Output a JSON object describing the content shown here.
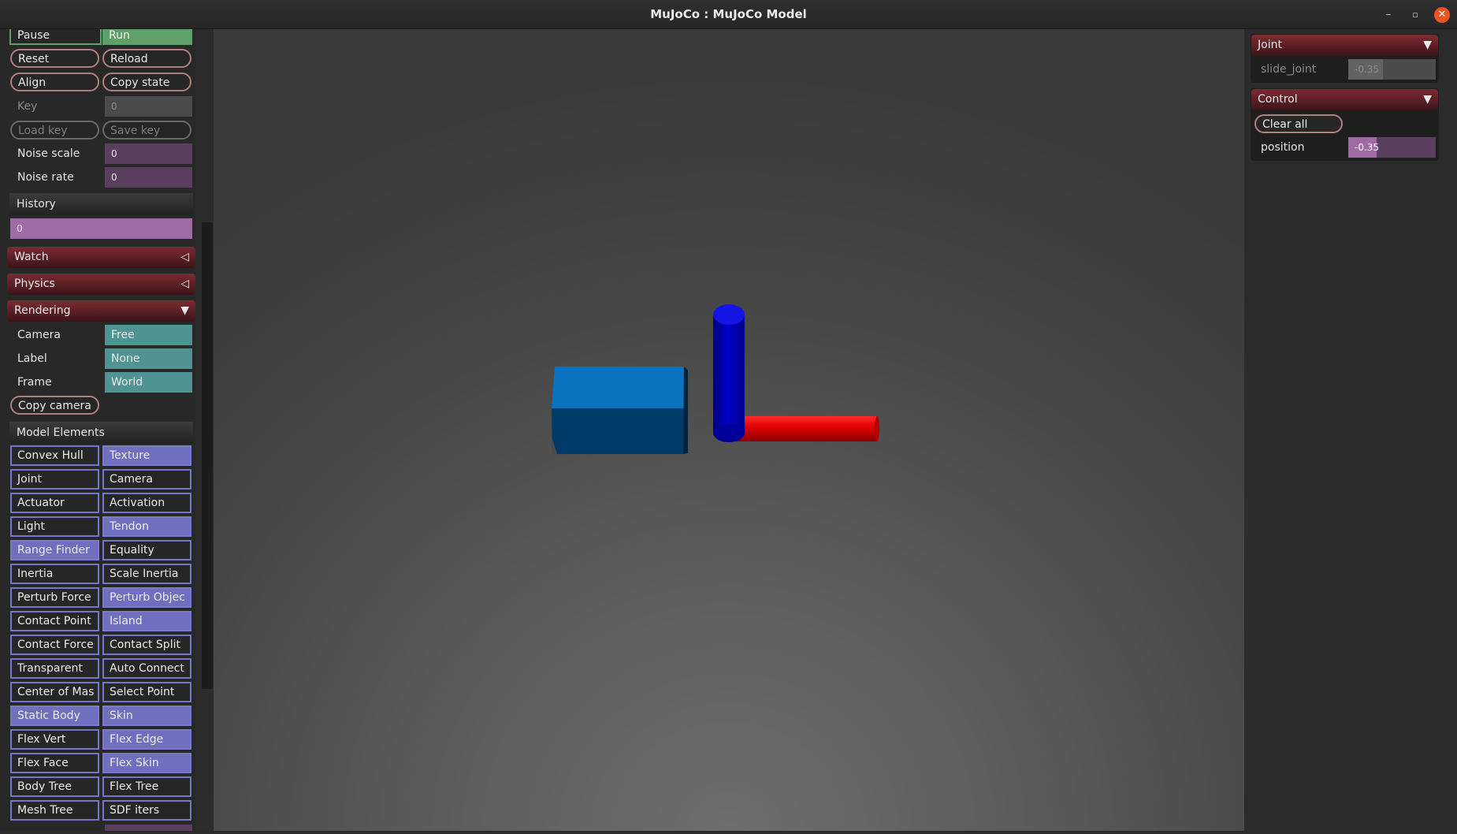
{
  "window": {
    "title": "MuJoCo : MuJoCo Model",
    "min_glyph": "–",
    "max_glyph": "▫",
    "close_glyph": "✕"
  },
  "simulation": {
    "pause_label": "Pause",
    "run_label": "Run",
    "reset_label": "Reset",
    "reload_label": "Reload",
    "align_label": "Align",
    "copy_state_label": "Copy state",
    "key_label": "Key",
    "key_value": "0",
    "load_key_label": "Load key",
    "save_key_label": "Save key",
    "noise_scale_label": "Noise scale",
    "noise_scale_value": "0",
    "noise_rate_label": "Noise rate",
    "noise_rate_value": "0",
    "history_label": "History",
    "history_value": "0"
  },
  "sections": {
    "watch": "Watch",
    "physics": "Physics",
    "rendering": "Rendering",
    "collapsed_arrow": "◁",
    "expanded_arrow": "▼"
  },
  "rendering": {
    "camera_label": "Camera",
    "camera_value": "Free",
    "label_label": "Label",
    "label_value": "None",
    "frame_label": "Frame",
    "frame_value": "World",
    "copy_camera_label": "Copy camera",
    "model_elements_label": "Model Elements"
  },
  "model_elements": [
    {
      "label": "Convex Hull",
      "on": false
    },
    {
      "label": "Texture",
      "on": true
    },
    {
      "label": "Joint",
      "on": false
    },
    {
      "label": "Camera",
      "on": false
    },
    {
      "label": "Actuator",
      "on": false
    },
    {
      "label": "Activation",
      "on": false
    },
    {
      "label": "Light",
      "on": false
    },
    {
      "label": "Tendon",
      "on": true
    },
    {
      "label": "Range Finder",
      "on": true
    },
    {
      "label": "Equality",
      "on": false
    },
    {
      "label": "Inertia",
      "on": false
    },
    {
      "label": "Scale Inertia",
      "on": false
    },
    {
      "label": "Perturb Force",
      "on": false
    },
    {
      "label": "Perturb Objec",
      "on": true
    },
    {
      "label": "Contact Point",
      "on": false
    },
    {
      "label": "Island",
      "on": true
    },
    {
      "label": "Contact Force",
      "on": false
    },
    {
      "label": "Contact Split",
      "on": false
    },
    {
      "label": "Transparent",
      "on": false
    },
    {
      "label": "Auto Connect",
      "on": false
    },
    {
      "label": "Center of Mas",
      "on": false
    },
    {
      "label": "Select Point",
      "on": false
    },
    {
      "label": "Static Body",
      "on": true
    },
    {
      "label": "Skin",
      "on": true
    },
    {
      "label": "Flex Vert",
      "on": false
    },
    {
      "label": "Flex Edge",
      "on": true
    },
    {
      "label": "Flex Face",
      "on": false
    },
    {
      "label": "Flex Skin",
      "on": true
    },
    {
      "label": "Body Tree",
      "on": false
    },
    {
      "label": "Flex Tree",
      "on": false
    },
    {
      "label": "Mesh Tree",
      "on": false
    },
    {
      "label": "SDF iters",
      "on": false
    }
  ],
  "joint_panel": {
    "title": "Joint",
    "arrow": "▼",
    "slide_joint_label": "slide_joint",
    "slide_joint_value": "-0.35",
    "slide_joint_fraction": 0.4
  },
  "control_panel": {
    "title": "Control",
    "arrow": "▼",
    "clear_all_label": "Clear all",
    "position_label": "position",
    "position_value": "-0.35",
    "position_fraction": 0.32
  },
  "colors": {
    "accent_red": "#6a2329",
    "run_green": "#5f9f6a",
    "toggle_on": "#6f6fc0",
    "box_blue": "#0a73c0",
    "capsule_blue": "#0000cc",
    "capsule_red": "#dd0000"
  }
}
